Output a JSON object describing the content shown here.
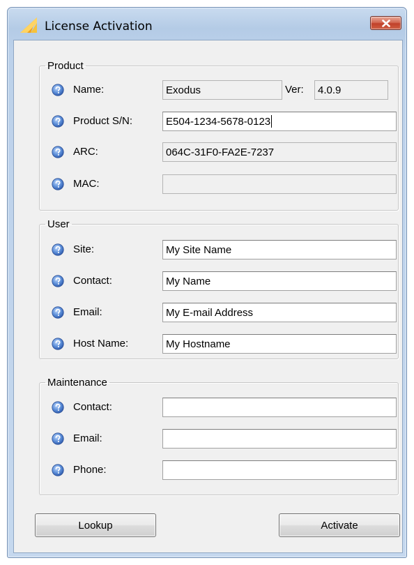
{
  "window": {
    "title": "License Activation",
    "close_glyph": "✕"
  },
  "product": {
    "legend": "Product",
    "name_label": "Name:",
    "name_value": "Exodus",
    "ver_label": "Ver:",
    "ver_value": "4.0.9",
    "sn_label": "Product S/N:",
    "sn_value": "E504-1234-5678-0123",
    "arc_label": "ARC:",
    "arc_value": "064C-31F0-FA2E-7237",
    "mac_label": "MAC:",
    "mac_value": ""
  },
  "user": {
    "legend": "User",
    "site_label": "Site:",
    "site_value": "My Site Name",
    "contact_label": "Contact:",
    "contact_value": "My Name",
    "email_label": "Email:",
    "email_value": "My E-mail Address",
    "host_label": "Host Name:",
    "host_value": "My Hostname"
  },
  "maintenance": {
    "legend": "Maintenance",
    "contact_label": "Contact:",
    "contact_value": "",
    "email_label": "Email:",
    "email_value": "",
    "phone_label": "Phone:",
    "phone_value": ""
  },
  "buttons": {
    "lookup": "Lookup",
    "activate": "Activate"
  },
  "icons": {
    "app": "license-logo-icon",
    "help": "help-question-icon",
    "close": "close-icon"
  },
  "colors": {
    "window_frame": "#b4cbe6",
    "close_button": "#c1412a",
    "help_icon": "#3d6fc4",
    "dialog_bg": "#f0f0f0"
  }
}
